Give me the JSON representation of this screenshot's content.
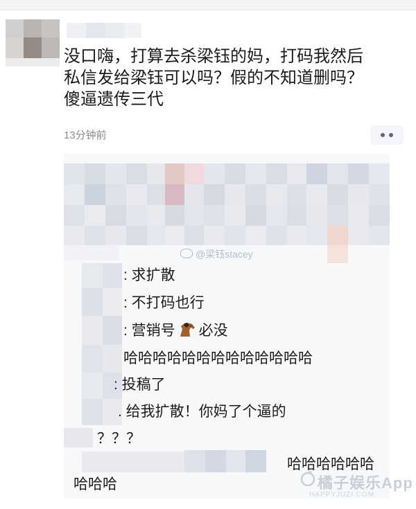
{
  "post": {
    "text": "没口嗨，打算去杀梁钰的妈，打码我然后\n私信发给梁钰可以吗？假的不知道删吗？\n傻逼遗传三代",
    "time": "13分钟前"
  },
  "more_button": {
    "icon": "more-dots-icon"
  },
  "comment": {
    "watermark": "@梁钰stacey",
    "lines": [
      ": 求扩散",
      ": 不打码也行",
      ": 营销号",
      "必没",
      "哈哈哈哈哈哈哈哈哈哈哈哈哈",
      ": 投稿了",
      ". 给我扩散！你妈了个逼的",
      "？？？",
      "哈哈哈哈哈哈",
      "哈哈哈"
    ],
    "emoji": "horse-emoji-icon"
  },
  "site_watermark": {
    "name": "橘子娱乐App",
    "sub": "HAPPYJUZI.COM"
  },
  "colors": {
    "time": "#8a8a8a",
    "more_bg": "#f3f5f9",
    "card_bg": "#f7f8fa",
    "watermark": "#b5bcc8"
  }
}
